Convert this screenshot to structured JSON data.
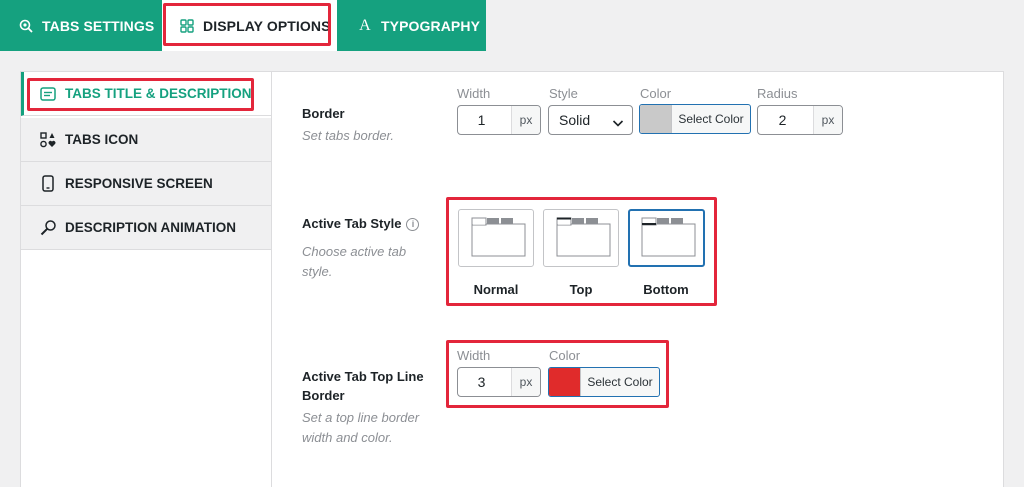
{
  "top_tabs": [
    {
      "label": "TABS SETTINGS",
      "icon": "gear-search-icon"
    },
    {
      "label": "DISPLAY OPTIONS",
      "icon": "grid-icon"
    },
    {
      "label": "TYPOGRAPHY",
      "icon": "font-icon"
    }
  ],
  "sidebar": {
    "items": [
      {
        "label": "TABS TITLE & DESCRIPTION",
        "icon": "title-icon"
      },
      {
        "label": "TABS ICON",
        "icon": "shapes-icon"
      },
      {
        "label": "RESPONSIVE SCREEN",
        "icon": "mobile-icon"
      },
      {
        "label": "DESCRIPTION ANIMATION",
        "icon": "magic-wand-icon"
      }
    ]
  },
  "border": {
    "label": "Border",
    "description": "Set tabs border.",
    "width_label": "Width",
    "width_value": "1",
    "width_unit": "px",
    "style_label": "Style",
    "style_value": "Solid",
    "color_label": "Color",
    "color_button": "Select Color",
    "color_value": "#c9c9c9",
    "radius_label": "Radius",
    "radius_value": "2",
    "radius_unit": "px"
  },
  "active_tab_style": {
    "label": "Active Tab Style",
    "info": "i",
    "description_line1": "Choose active tab",
    "description_line2": "style.",
    "options": [
      "Normal",
      "Top",
      "Bottom"
    ],
    "selected": "Bottom"
  },
  "top_line_border": {
    "label_line1": "Active Tab Top Line",
    "label_line2": "Border",
    "description_line1": "Set a top line border",
    "description_line2": "width and color.",
    "width_label": "Width",
    "width_value": "3",
    "width_unit": "px",
    "color_label": "Color",
    "color_button": "Select Color",
    "color_value": "#e02b2b"
  },
  "colors": {
    "accent": "#15a17f",
    "highlight": "#e3263b",
    "focus": "#2271b1"
  }
}
